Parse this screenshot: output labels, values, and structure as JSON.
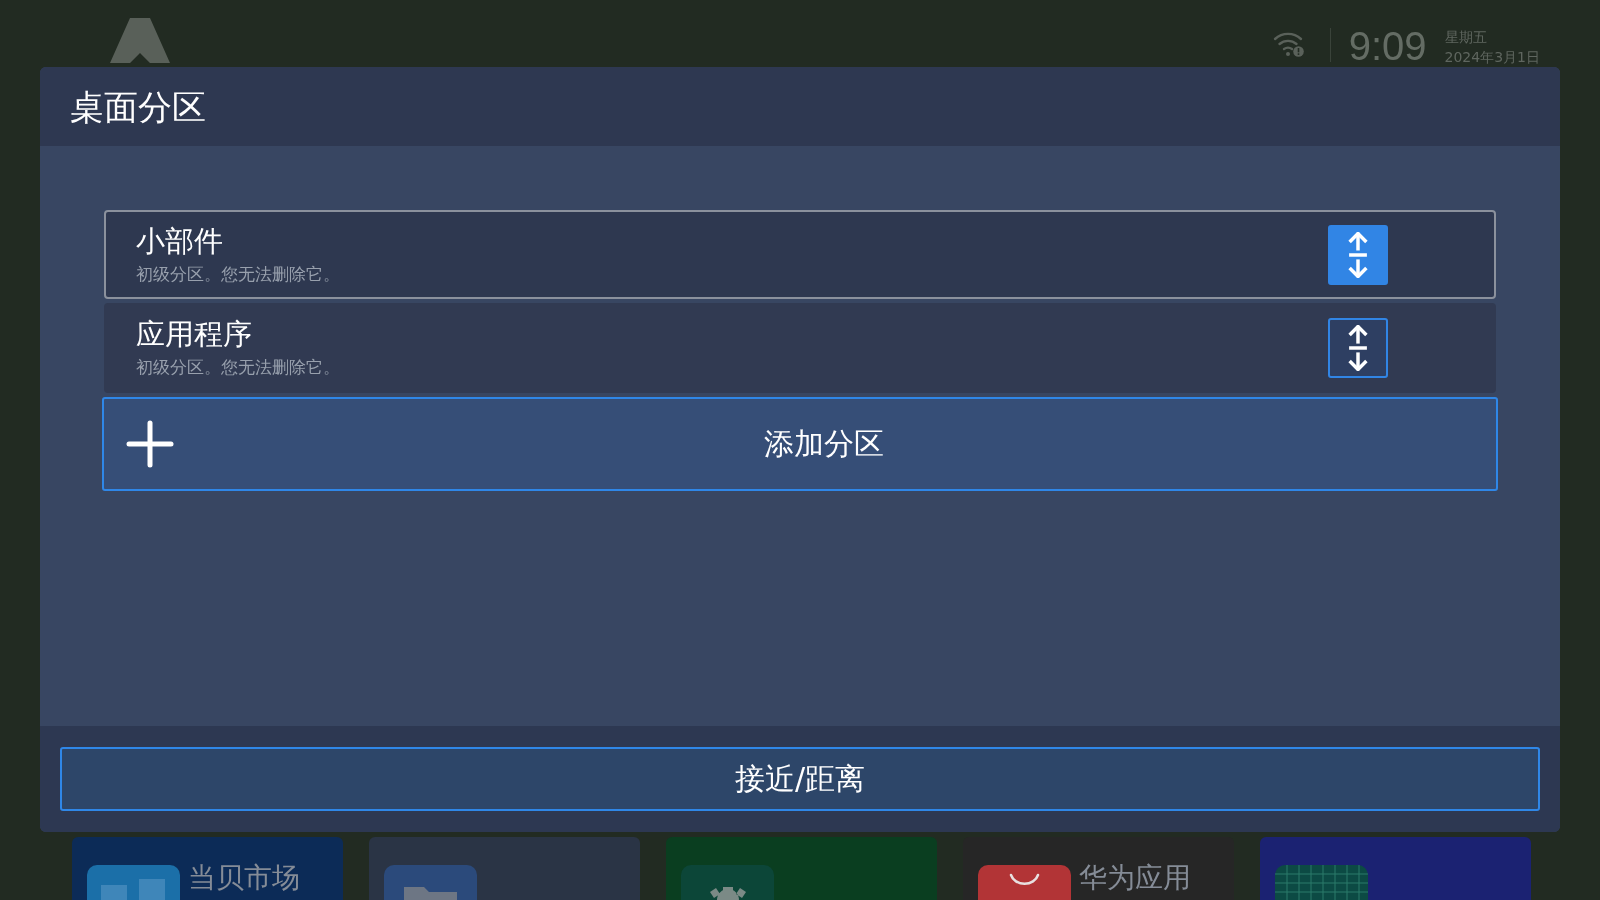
{
  "status_bar": {
    "time": "9:09",
    "weekday": "星期五",
    "date": "2024年3月1日"
  },
  "dialog": {
    "title": "桌面分区",
    "sections": [
      {
        "title": "小部件",
        "subtitle": "初级分区。您无法删除它。",
        "selected": true
      },
      {
        "title": "应用程序",
        "subtitle": "初级分区。您无法删除它。",
        "selected": false
      }
    ],
    "add_button": {
      "label": "添加分区"
    },
    "footer_button": {
      "label": "接近/距离"
    }
  },
  "home_tiles": [
    {
      "kind": "market",
      "color": "#0c2b57",
      "label": "当贝市场"
    },
    {
      "kind": "folder",
      "color": "#2a3445"
    },
    {
      "kind": "gear",
      "color": "#0a3e20"
    },
    {
      "kind": "bag",
      "color": "#262626",
      "label": "华为应用"
    },
    {
      "kind": "grid",
      "color": "#1b2272"
    }
  ]
}
